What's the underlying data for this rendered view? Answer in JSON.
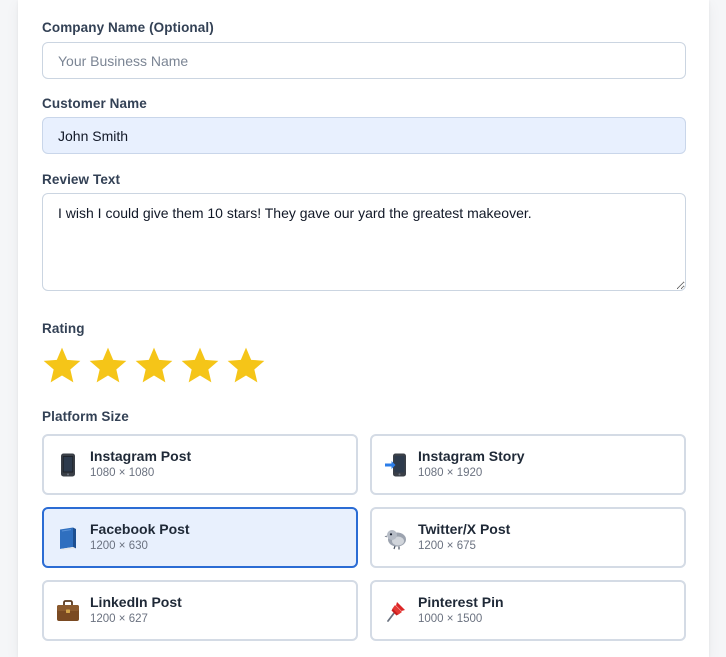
{
  "company": {
    "label": "Company Name (Optional)",
    "placeholder": "Your Business Name",
    "value": ""
  },
  "customer": {
    "label": "Customer Name",
    "value": "John Smith"
  },
  "review": {
    "label": "Review Text",
    "value": "I wish I could give them 10 stars! They gave our yard the greatest makeover."
  },
  "rating": {
    "label": "Rating",
    "value": 5,
    "max": 5,
    "star_color": "#f5c518"
  },
  "platform": {
    "label": "Platform Size",
    "selected": "facebook-post",
    "options": [
      {
        "id": "instagram-post",
        "name": "Instagram Post",
        "size": "1080 × 1080",
        "icon": "mobile-phone-icon"
      },
      {
        "id": "instagram-story",
        "name": "Instagram Story",
        "size": "1080 × 1920",
        "icon": "phone-with-arrow-icon"
      },
      {
        "id": "facebook-post",
        "name": "Facebook Post",
        "size": "1200 × 630",
        "icon": "blue-book-icon"
      },
      {
        "id": "twitter-x-post",
        "name": "Twitter/X Post",
        "size": "1200 × 675",
        "icon": "bird-icon"
      },
      {
        "id": "linkedin-post",
        "name": "LinkedIn Post",
        "size": "1200 × 627",
        "icon": "briefcase-icon"
      },
      {
        "id": "pinterest-pin",
        "name": "Pinterest Pin",
        "size": "1000 × 1500",
        "icon": "pushpin-icon"
      }
    ]
  },
  "colors": {
    "accent": "#2b6cd4",
    "selected_bg": "#e8f0fd",
    "filled_input_bg": "#e8f0fe",
    "border": "#cbd5e1"
  }
}
